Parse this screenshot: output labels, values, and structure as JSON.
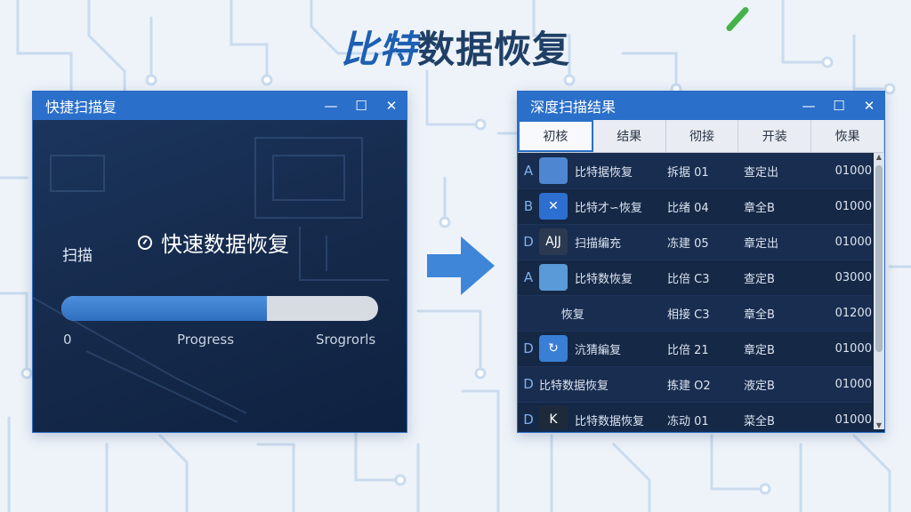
{
  "headline": {
    "accent": "比特",
    "rest": "数据恢复"
  },
  "left_window": {
    "title": "快捷扫描复",
    "quick_title": "快速数据恢复",
    "scan_label": "扫描",
    "progress": 0.65,
    "label_start": "0",
    "label_mid": "Progress",
    "label_end": "Srogrorls"
  },
  "right_window": {
    "title": "深度扫描结果",
    "tabs": [
      "初核",
      "结果",
      "彻接",
      "开装",
      "恢果"
    ],
    "rows": [
      {
        "letter": "A",
        "thumb": "",
        "thumb_color": "#4f86d1",
        "name": "比特据恢复",
        "c2": "拆据 01",
        "c3": "查定出",
        "c4": "01000"
      },
      {
        "letter": "B",
        "thumb": "✕",
        "thumb_color": "#2d6fd0",
        "name": "比特才∽恢复",
        "c2": "比绪 04",
        "c3": "章全B",
        "c4": "01000"
      },
      {
        "letter": "D",
        "thumb": "AJJ",
        "thumb_color": "#2b3a50",
        "name": "扫描编充",
        "c2": "冻建 05",
        "c3": "章定出",
        "c4": "01000"
      },
      {
        "letter": "A",
        "thumb": "",
        "thumb_color": "#5a9ad8",
        "name": "比特数恢复",
        "c2": "比倍 C3",
        "c3": "查定B",
        "c4": "03000"
      },
      {
        "letter": "",
        "thumb": "",
        "thumb_color": "",
        "name": "      恢复",
        "c2": "相接 C3",
        "c3": "章全B",
        "c4": "01200"
      },
      {
        "letter": "D",
        "thumb": "↻",
        "thumb_color": "#3a7fd6",
        "name": "沆猜編复",
        "c2": "比倍 21",
        "c3": "章定B",
        "c4": "01000"
      },
      {
        "letter": "D",
        "thumb": "",
        "thumb_color": "",
        "name": "比特数据恢复",
        "c2": "拣建 O2",
        "c3": "液定B",
        "c4": "01000"
      },
      {
        "letter": "D",
        "thumb": "K",
        "thumb_color": "#1e2a3a",
        "name": "比特数据恢复",
        "c2": "冻动 01",
        "c3": "菜全B",
        "c4": "01000"
      }
    ]
  },
  "colors": {
    "accent": "#2a6fc9",
    "headline": "#1f3f66",
    "arrow": "#3f86d9"
  }
}
